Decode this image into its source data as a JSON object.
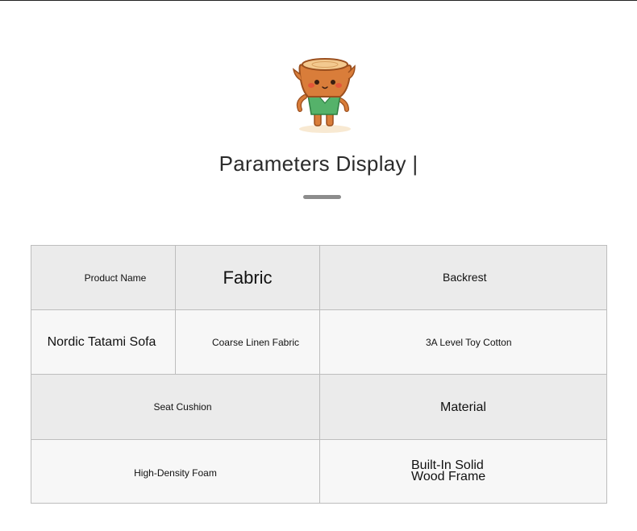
{
  "header": {
    "title": "Parameters Display |"
  },
  "mascot": {
    "icon": "wood-stump-mascot-icon",
    "colors": {
      "body": "#d97d3a",
      "body_outline": "#9b4f1e",
      "top": "#f3c98f",
      "shirt": "#55b26a",
      "blush": "#e84a3a"
    }
  },
  "table": {
    "row1": {
      "product_name_label": "Product Name",
      "fabric_label": "Fabric",
      "backrest_label": "Backrest"
    },
    "row2": {
      "product_name_value": "Nordic Tatami Sofa",
      "fabric_value": "Coarse Linen Fabric",
      "backrest_value": "3A Level Toy Cotton"
    },
    "row3": {
      "seat_cushion_label": "Seat Cushion",
      "material_label": "Material"
    },
    "row4": {
      "seat_cushion_value": "High-Density Foam",
      "material_value_line1": "Built-In Solid",
      "material_value_line2": "Wood Frame"
    }
  },
  "colors": {
    "header_cell_bg": "#ebebeb",
    "value_cell_bg": "#f7f7f7",
    "border": "#bdbdbd",
    "underline": "#8c8c8c"
  }
}
